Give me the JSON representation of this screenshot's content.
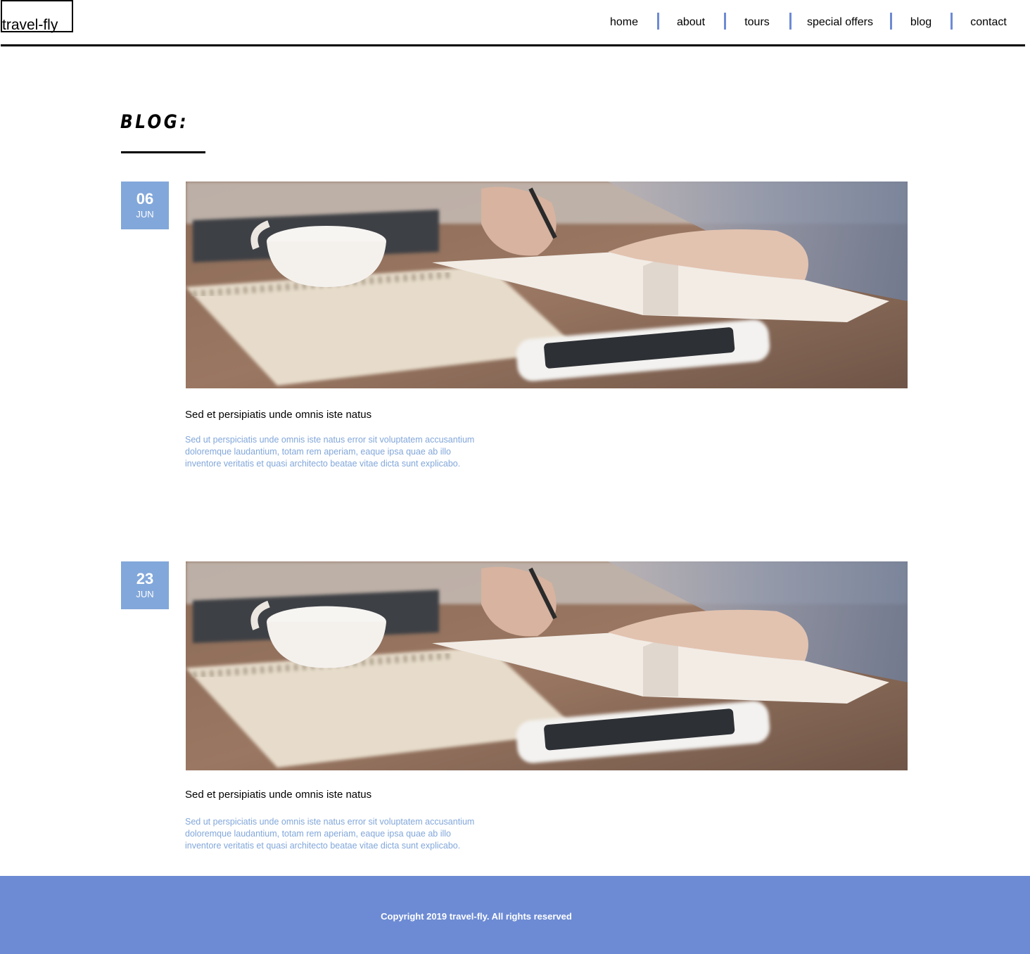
{
  "header": {
    "logo": "travel-fly",
    "nav": [
      {
        "label": "home"
      },
      {
        "label": "about"
      },
      {
        "label": "tours"
      },
      {
        "label": "special offers"
      },
      {
        "label": "blog"
      },
      {
        "label": "contact"
      }
    ]
  },
  "page": {
    "title": "BLOG:"
  },
  "posts": [
    {
      "day": "06",
      "month": "JUN",
      "image": "desk-notebook-coffee-photo",
      "heading": "Sed et persipiatis unde omnis iste natus",
      "excerpt": "Sed ut perspiciatis unde omnis iste natus error sit voluptatem accusantium doloremque laudantium, totam rem aperiam, eaque ipsa quae ab illo inventore veritatis et quasi architecto beatae vitae dicta sunt explicabo."
    },
    {
      "day": "23",
      "month": "JUN",
      "image": "desk-notebook-coffee-photo",
      "heading": "Sed et persipiatis unde omnis iste natus",
      "excerpt": "Sed ut perspiciatis unde omnis iste natus error sit voluptatem accusantium doloremque laudantium, totam rem aperiam, eaque ipsa quae ab illo inventore veritatis et quasi architecto beatae vitae dicta sunt explicabo."
    }
  ],
  "footer": {
    "copyright": "Copyright 2019 travel-fly. All rights reserved"
  },
  "colors": {
    "accent": "#6d8bd4",
    "date_badge": "#82a7da",
    "excerpt_text": "#82a7da"
  }
}
